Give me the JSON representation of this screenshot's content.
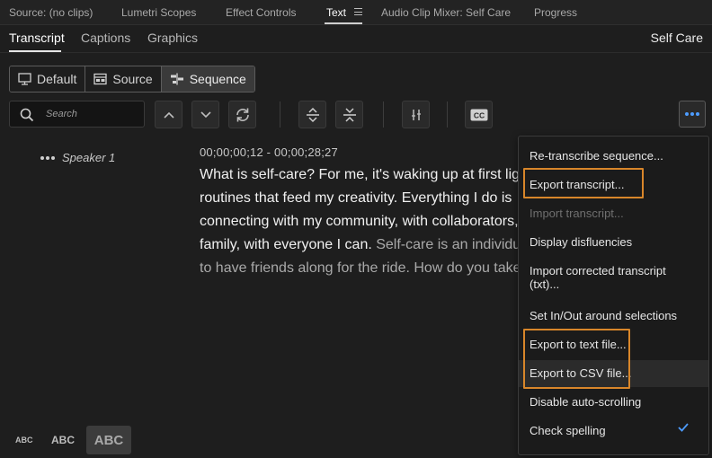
{
  "panel_tabs": [
    "Source: (no clips)",
    "Lumetri Scopes",
    "Effect Controls",
    "Text",
    "Audio Clip Mixer: Self Care",
    "Progress"
  ],
  "active_panel_tab": "Text",
  "sub_tabs": [
    "Transcript",
    "Captions",
    "Graphics"
  ],
  "active_sub_tab": "Transcript",
  "sequence_name": "Self Care",
  "view_modes": [
    "Default",
    "Source",
    "Sequence"
  ],
  "active_view_mode": "Sequence",
  "search": {
    "placeholder": "Search"
  },
  "transcript": {
    "speaker": "Speaker 1",
    "timecode": "00;00;00;12 - 00;00;28;27",
    "lines": [
      {
        "text": "What is self-care? For me, it's waking up at first light,",
        "dim_text": ""
      },
      {
        "text": "routines that feed my creativity. Everything I do is",
        "dim_text": ""
      },
      {
        "text": "connecting with my community, with collaborators,",
        "dim_text": ""
      },
      {
        "text": "family, with everyone I can. ",
        "dim_text": "Self-care is an individual"
      },
      {
        "text": "",
        "dim_text": "to have friends along for the ride. How do you take"
      }
    ]
  },
  "text_sizes": [
    "ABC",
    "ABC",
    "ABC"
  ],
  "menu": {
    "items": [
      {
        "label": "Re-transcribe sequence...",
        "enabled": true
      },
      {
        "label": "Export transcript...",
        "enabled": true
      },
      {
        "label": "Import transcript...",
        "enabled": false
      },
      {
        "label": "Display disfluencies",
        "enabled": true
      },
      {
        "label": "Import corrected transcript",
        "label2": "(txt)...",
        "enabled": true
      },
      {
        "label": "Set In/Out around selections",
        "enabled": true
      },
      {
        "label": "Export to text file...",
        "enabled": true
      },
      {
        "label": "Export to CSV file...",
        "enabled": true
      },
      {
        "label": "Disable auto-scrolling",
        "enabled": true
      },
      {
        "label": "Check spelling",
        "enabled": true,
        "checked": true
      }
    ]
  },
  "colors": {
    "accent": "#4d9cff",
    "highlight": "#d8862a",
    "background": "#1e1e1e"
  },
  "icons": {
    "search": "search-icon",
    "prev": "chevron-up-icon",
    "next": "chevron-down-icon",
    "refresh": "refresh-icon",
    "expand": "expand-icon",
    "collapse": "collapse-icon",
    "split": "split-segment-icon",
    "captions": "cc-icon",
    "more": "more-options-icon"
  }
}
